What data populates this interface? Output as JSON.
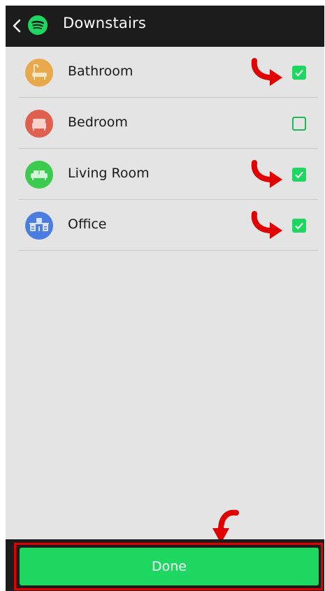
{
  "header": {
    "title": "Downstairs",
    "back_icon": "chevron-left-icon",
    "app_icon": "spotify-logo-icon"
  },
  "rooms": [
    {
      "label": "Bathroom",
      "checked": true,
      "icon": "bathtub-icon",
      "color": "#e8a84c"
    },
    {
      "label": "Bedroom",
      "checked": false,
      "icon": "bed-icon",
      "color": "#e0604f"
    },
    {
      "label": "Living Room",
      "checked": true,
      "icon": "sofa-icon",
      "color": "#3ccb4f"
    },
    {
      "label": "Office",
      "checked": true,
      "icon": "desk-icon",
      "color": "#4b7de0"
    }
  ],
  "footer": {
    "done_label": "Done"
  },
  "colors": {
    "accent": "#1ed760",
    "header_bg": "#1c1c1c",
    "content_bg": "#e4e4e4",
    "annotation": "#e00000"
  }
}
